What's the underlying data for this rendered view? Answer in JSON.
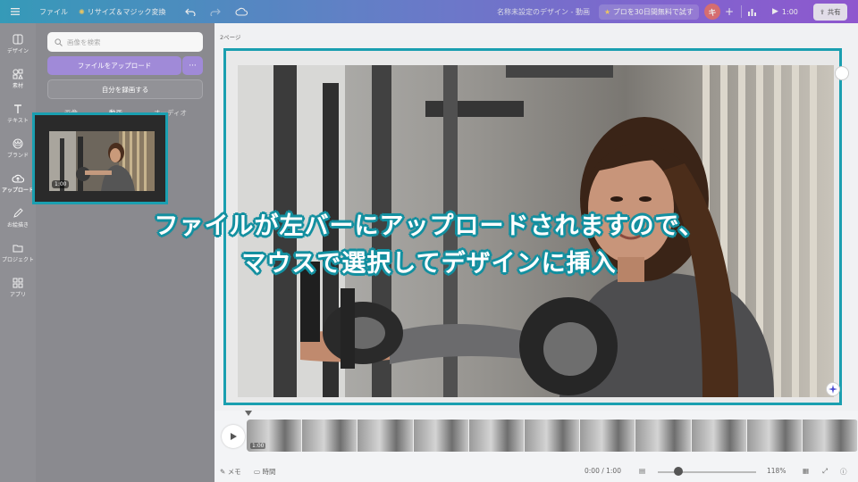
{
  "topbar": {
    "menu_icon": "hamburger-icon",
    "file_label": "ファイル",
    "resize_label": "リサイズ＆マジック変換",
    "undo_icon": "undo-icon",
    "redo_icon": "redo-icon",
    "cloud_icon": "cloud-icon",
    "design_title": "名称未設定のデザイン - 動画",
    "pro_trial_label": "プロを30日間無料で試す",
    "avatar_initial": "キ",
    "add_icon": "plus-icon",
    "analytics_icon": "bar-chart-icon",
    "play_duration": "1:00",
    "share_label": "共有"
  },
  "rail": {
    "items": [
      {
        "label": "デザイン",
        "icon": "layout-icon"
      },
      {
        "label": "素材",
        "icon": "shapes-icon"
      },
      {
        "label": "テキスト",
        "icon": "text-icon"
      },
      {
        "label": "ブランド",
        "icon": "crown-icon"
      },
      {
        "label": "アップロード",
        "icon": "upload-cloud-icon"
      },
      {
        "label": "お絵描き",
        "icon": "pen-icon"
      },
      {
        "label": "プロジェクト",
        "icon": "folder-icon"
      },
      {
        "label": "アプリ",
        "icon": "grid-icon"
      }
    ]
  },
  "panel": {
    "search_placeholder": "画像を検索",
    "upload_button": "ファイルをアップロード",
    "upload_more": "···",
    "record_button": "自分を録画する",
    "tabs": [
      "画像",
      "動画",
      "オーディオ"
    ],
    "uploaded_video_duration": "1:00"
  },
  "canvas": {
    "page_label": "2ページ"
  },
  "timeline": {
    "clip_duration": "1:00"
  },
  "bottom": {
    "notes_label": "メモ",
    "timer_label": "時間",
    "time_readout": "0:00 / 1:00",
    "zoom_label": "118%",
    "zoom_level_percent": 118
  },
  "caption": {
    "line1": "ファイルが左バーにアップロードされますので、",
    "line2": "マウスで選択してデザインに挿入"
  },
  "colors": {
    "highlight_border": "#1a9fb0",
    "caption_outline": "#1590a0",
    "accent_purple": "#a08ad8"
  }
}
